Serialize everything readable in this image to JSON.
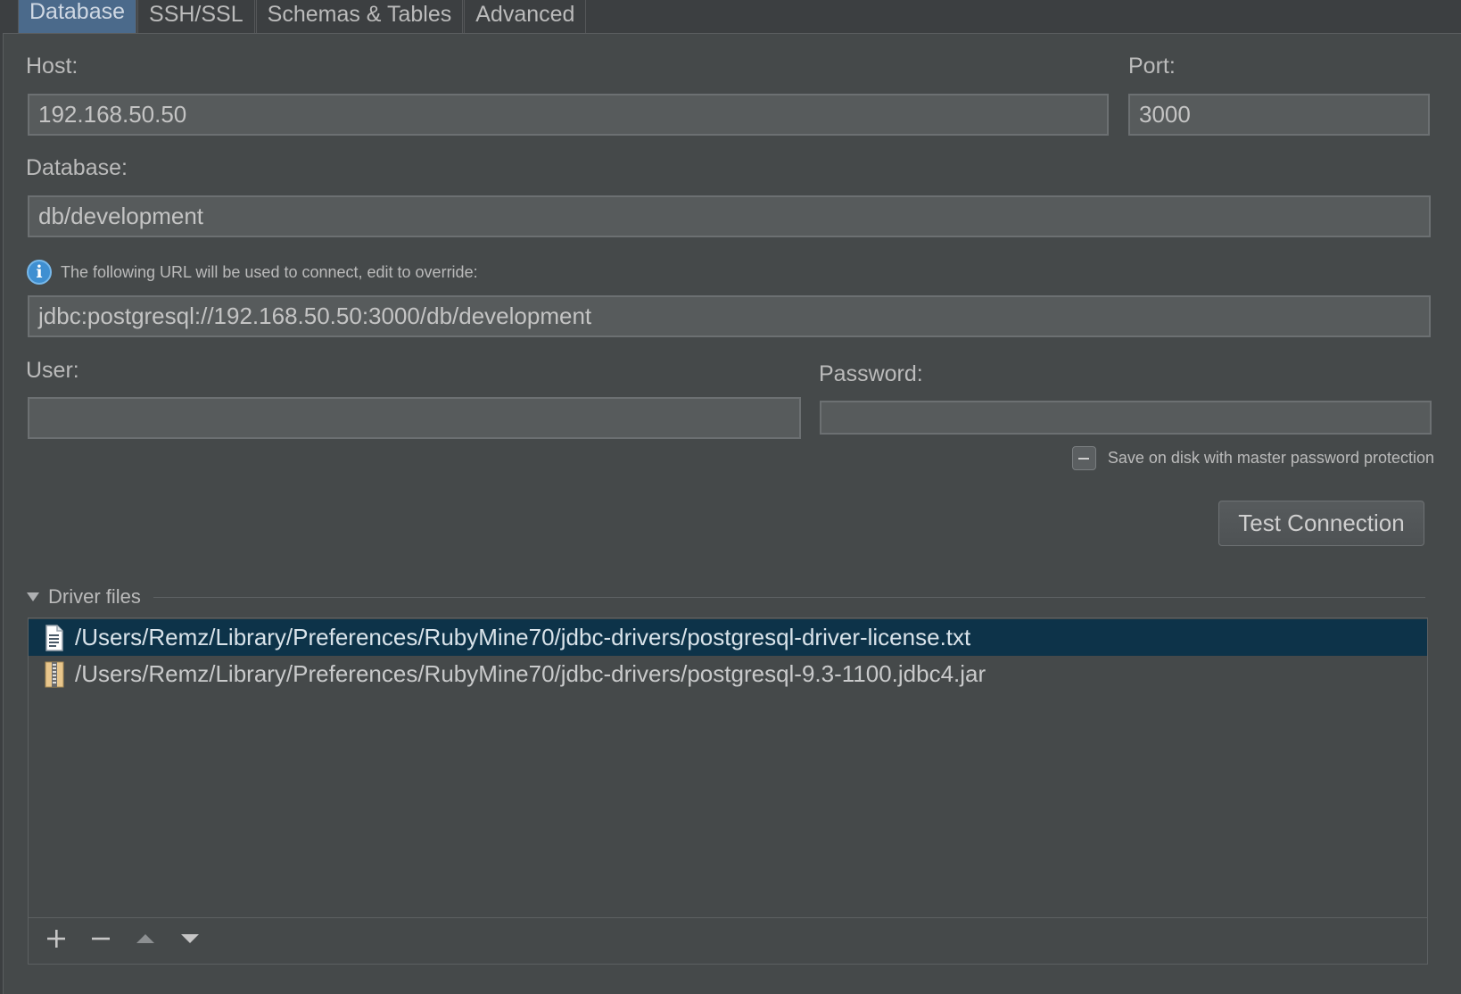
{
  "tabs": [
    {
      "label": "Database",
      "active": true
    },
    {
      "label": "SSH/SSL",
      "active": false
    },
    {
      "label": "Schemas & Tables",
      "active": false
    },
    {
      "label": "Advanced",
      "active": false
    }
  ],
  "form": {
    "host_label": "Host:",
    "host_value": "192.168.50.50",
    "port_label": "Port:",
    "port_value": "3000",
    "database_label": "Database:",
    "database_value": "db/development",
    "url_info": "The following URL will be used to connect, edit to override:",
    "url_value": "jdbc:postgresql://192.168.50.50:3000/db/development",
    "user_label": "User:",
    "user_value": "",
    "password_label": "Password:",
    "password_value": "",
    "save_checkbox_label": "Save on disk with master password protection",
    "test_button_label": "Test Connection"
  },
  "driver_files": {
    "title": "Driver files",
    "items": [
      {
        "path": "/Users/Remz/Library/Preferences/RubyMine70/jdbc-drivers/postgresql-driver-license.txt",
        "icon": "text-file-icon",
        "selected": true
      },
      {
        "path": "/Users/Remz/Library/Preferences/RubyMine70/jdbc-drivers/postgresql-9.3-1100.jdbc4.jar",
        "icon": "jar-archive-icon",
        "selected": false
      }
    ],
    "toolbar": [
      "add-icon",
      "remove-icon",
      "move-up-icon",
      "move-down-icon"
    ]
  },
  "colors": {
    "background": "#3c3f41",
    "panel": "#45494a",
    "active_tab": "#4b6a8b",
    "selection": "#0d3349",
    "info_icon": "#3f8fd1"
  }
}
